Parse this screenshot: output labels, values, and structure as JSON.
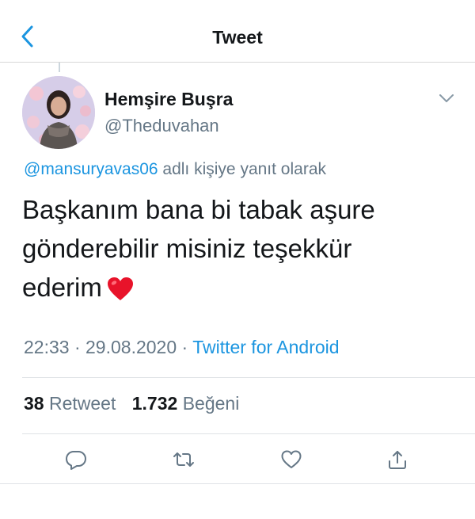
{
  "header": {
    "title": "Tweet",
    "back_icon": "chevron-left-icon"
  },
  "author": {
    "name": "Hemşire Buşra",
    "handle": "@Theduvahan"
  },
  "reply_context": {
    "mention": "@mansuryavas06",
    "suffix": "adlı kişiye yanıt olarak"
  },
  "tweet": {
    "text": "Başkanım bana bi tabak aşure\ngönderebilir misiniz teşekkür\nederim",
    "emoji": "red-heart"
  },
  "meta": {
    "time": "22:33",
    "separator1": "·",
    "date": "29.08.2020",
    "separator2": "·",
    "source": "Twitter for Android"
  },
  "stats": {
    "retweet_count": "38",
    "retweet_label": "Retweet",
    "like_count": "1.732",
    "like_label": "Beğeni"
  },
  "actions": {
    "reply_icon": "comment-icon",
    "retweet_icon": "retweet-icon",
    "like_icon": "heart-icon",
    "share_icon": "share-icon"
  },
  "colors": {
    "accent": "#1b95e0",
    "secondary_text": "#657786",
    "primary_text": "#14171a",
    "heart": "#e0245e",
    "divider": "#dfe3e6"
  }
}
